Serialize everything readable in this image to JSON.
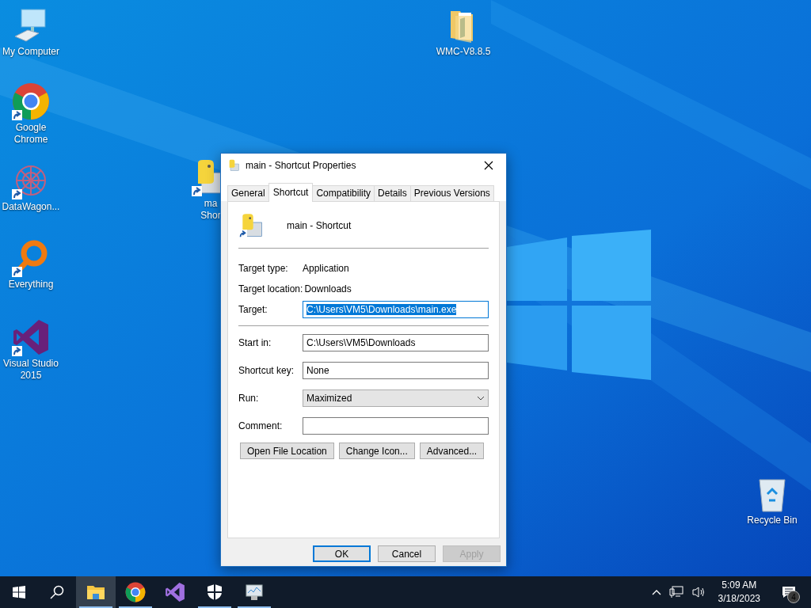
{
  "desktop_icons": [
    {
      "kind": "computer",
      "label": "My Computer",
      "shortcut": false
    },
    {
      "kind": "chrome",
      "label": "Google Chrome",
      "shortcut": true
    },
    {
      "kind": "datawagon",
      "label": "DataWagon...",
      "shortcut": true
    },
    {
      "kind": "everything",
      "label": "Everything",
      "shortcut": true
    },
    {
      "kind": "vs",
      "label": "Visual Studio 2015",
      "shortcut": true
    },
    {
      "kind": "folder",
      "label": "WMC-V8.8.5",
      "shortcut": false
    },
    {
      "kind": "python",
      "label": "ma\nShor",
      "shortcut": true
    },
    {
      "kind": "recycle",
      "label": "Recycle Bin",
      "shortcut": false
    }
  ],
  "dialog": {
    "title": "main - Shortcut Properties",
    "tabs": [
      {
        "label": "General",
        "selected": false
      },
      {
        "label": "Shortcut",
        "selected": true
      },
      {
        "label": "Compatibility",
        "selected": false
      },
      {
        "label": "Details",
        "selected": false
      },
      {
        "label": "Previous Versions",
        "selected": false
      }
    ],
    "name": "main - Shortcut",
    "info": [
      {
        "label": "Target type:",
        "value": "Application"
      },
      {
        "label": "Target location:",
        "value": "Downloads"
      }
    ],
    "target": {
      "label": "Target:",
      "value": "C:\\Users\\VM5\\Downloads\\main.exe",
      "selected": true
    },
    "fields": [
      {
        "kind": "text",
        "label": "Start in:",
        "value": "C:\\Users\\VM5\\Downloads"
      },
      {
        "kind": "text",
        "label": "Shortcut key:",
        "value": "None"
      },
      {
        "kind": "dropdown",
        "label": "Run:",
        "value": "Maximized"
      },
      {
        "kind": "text",
        "label": "Comment:"
      }
    ],
    "actions": [
      "Open File Location",
      "Change Icon...",
      "Advanced..."
    ],
    "footer": [
      {
        "label": "OK",
        "default": true,
        "disabled": false
      },
      {
        "label": "Cancel",
        "default": false,
        "disabled": false
      },
      {
        "label": "Apply",
        "default": false,
        "disabled": true
      }
    ]
  },
  "taskbar": {
    "apps": [
      {
        "kind": "explorer",
        "running": true,
        "active": true
      },
      {
        "kind": "chrome",
        "running": true,
        "active": false
      },
      {
        "kind": "vs",
        "running": false,
        "active": false
      },
      {
        "kind": "shield",
        "running": true,
        "active": false
      },
      {
        "kind": "monitor",
        "running": true,
        "active": false
      }
    ],
    "time": "5:09 AM",
    "date": "3/18/2023",
    "notifications": "4"
  }
}
